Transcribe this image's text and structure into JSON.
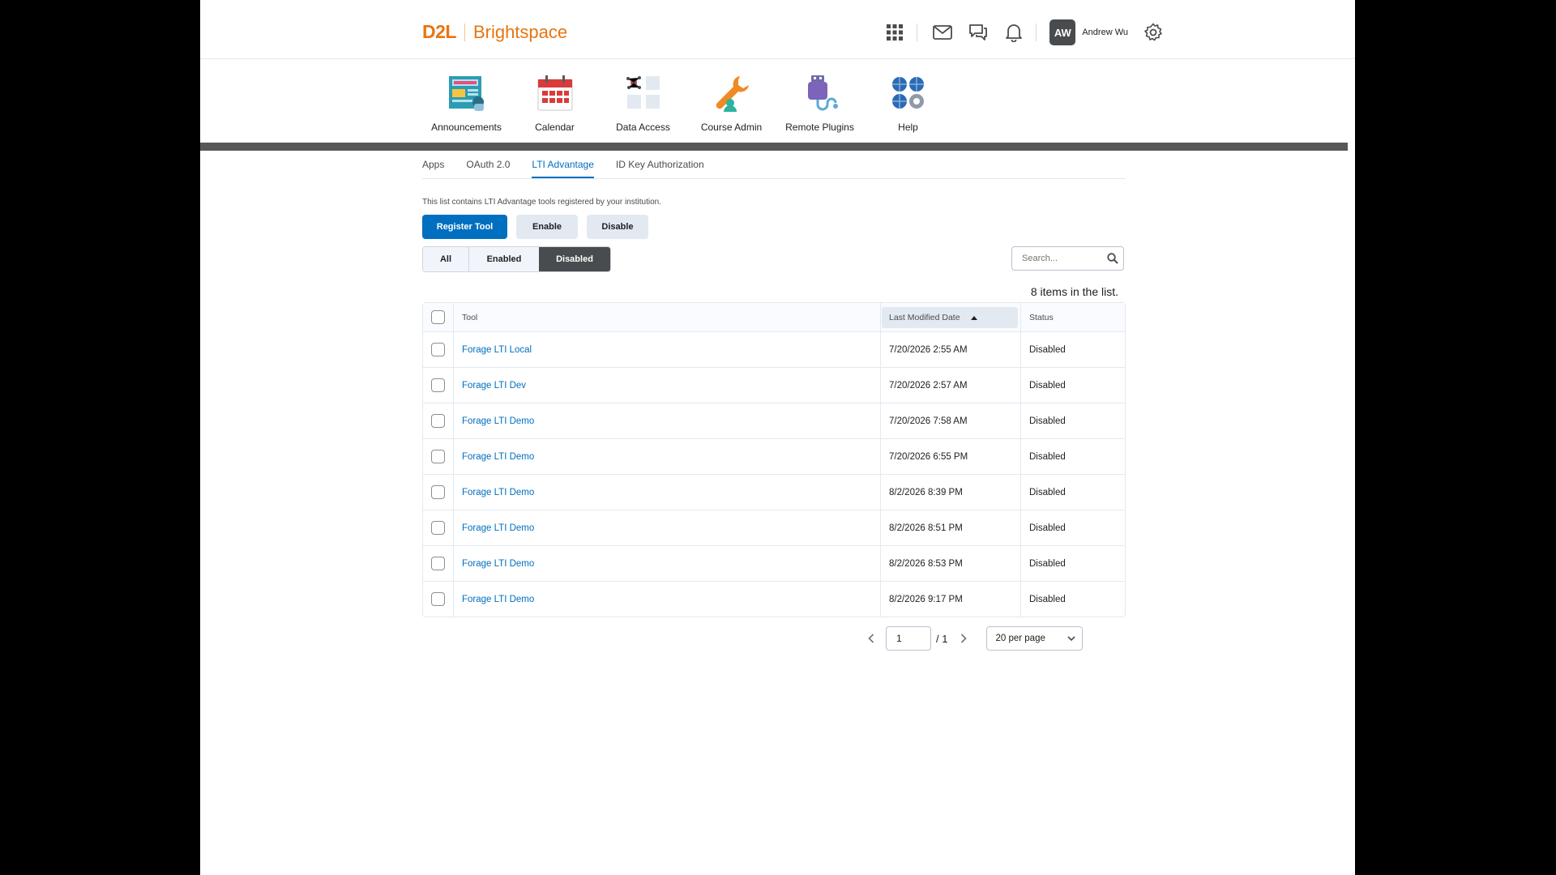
{
  "header": {
    "logo_brand": "D2L",
    "logo_product": "Brightspace",
    "avatar_initials": "AW",
    "user_name": "Andrew Wu"
  },
  "nav": {
    "items": [
      {
        "label": "Announcements",
        "icon": "announcements-icon"
      },
      {
        "label": "Calendar",
        "icon": "calendar-icon"
      },
      {
        "label": "Data Access",
        "icon": "data-access-icon"
      },
      {
        "label": "Course Admin",
        "icon": "course-admin-icon"
      },
      {
        "label": "Remote Plugins",
        "icon": "remote-plugins-icon"
      },
      {
        "label": "Help",
        "icon": "help-icon"
      }
    ]
  },
  "tabs": [
    {
      "label": "Apps",
      "active": false
    },
    {
      "label": "OAuth 2.0",
      "active": false
    },
    {
      "label": "LTI Advantage",
      "active": true
    },
    {
      "label": "ID Key Authorization",
      "active": false
    }
  ],
  "description": "This list contains LTI Advantage tools registered by your institution.",
  "actions": {
    "register": "Register Tool",
    "enable": "Enable",
    "disable": "Disable"
  },
  "filters": {
    "all": "All",
    "enabled": "Enabled",
    "disabled": "Disabled",
    "selected": "Disabled"
  },
  "search": {
    "placeholder": "Search..."
  },
  "count_text": "8 items in the list.",
  "table": {
    "columns": {
      "tool": "Tool",
      "date": "Last Modified Date",
      "status": "Status"
    },
    "rows": [
      {
        "tool": "Forage LTI Local",
        "date": "7/20/2026 2:55 AM",
        "status": "Disabled"
      },
      {
        "tool": "Forage LTI Dev",
        "date": "7/20/2026 2:57 AM",
        "status": "Disabled"
      },
      {
        "tool": "Forage LTI Demo",
        "date": "7/20/2026 7:58 AM",
        "status": "Disabled"
      },
      {
        "tool": "Forage LTI Demo",
        "date": "7/20/2026 6:55 PM",
        "status": "Disabled"
      },
      {
        "tool": "Forage LTI Demo",
        "date": "8/2/2026 8:39 PM",
        "status": "Disabled"
      },
      {
        "tool": "Forage LTI Demo",
        "date": "8/2/2026 8:51 PM",
        "status": "Disabled"
      },
      {
        "tool": "Forage LTI Demo",
        "date": "8/2/2026 8:53 PM",
        "status": "Disabled"
      },
      {
        "tool": "Forage LTI Demo",
        "date": "8/2/2026 9:17 PM",
        "status": "Disabled"
      }
    ]
  },
  "pager": {
    "page": "1",
    "total": "/ 1",
    "per_page": "20 per page"
  },
  "colors": {
    "brand": "#e87511",
    "link": "#006fbf",
    "primary_button": "#006fbf",
    "active_filter": "#494c4e"
  }
}
